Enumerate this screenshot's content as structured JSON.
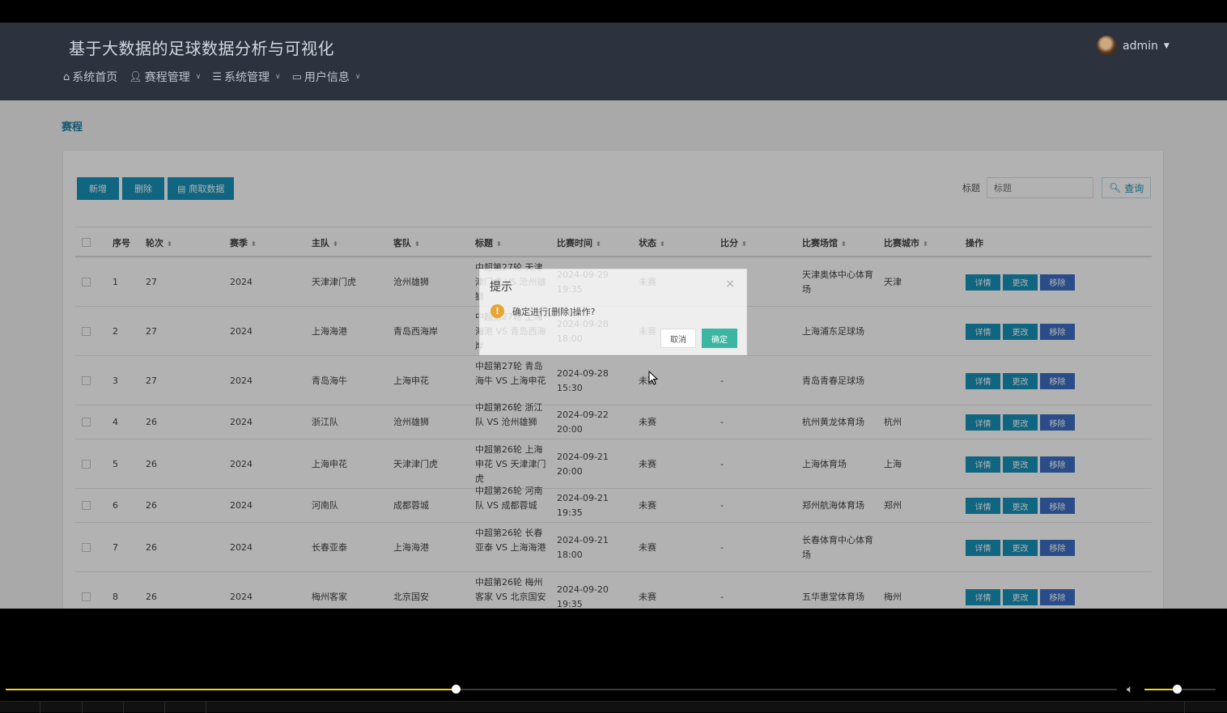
{
  "header": {
    "app_title": "基于大数据的足球数据分析与可视化",
    "nav": [
      {
        "label": "系统首页",
        "icon": "home-icon",
        "has_dropdown": false
      },
      {
        "label": "赛程管理",
        "icon": "user-icon",
        "has_dropdown": true
      },
      {
        "label": "系统管理",
        "icon": "list-icon",
        "has_dropdown": true
      },
      {
        "label": "用户信息",
        "icon": "card-icon",
        "has_dropdown": true
      }
    ],
    "user": "admin"
  },
  "breadcrumb": "赛程",
  "toolbar": {
    "add_label": "新增",
    "delete_label": "删除",
    "crawl_label": "爬取数据"
  },
  "search": {
    "label": "标题",
    "placeholder": "标题",
    "button_label": "查询"
  },
  "table": {
    "columns": [
      "序号",
      "轮次",
      "赛季",
      "主队",
      "客队",
      "标题",
      "比赛时间",
      "状态",
      "比分",
      "比赛场馆",
      "比赛城市",
      "操作"
    ],
    "op_labels": {
      "detail": "详情",
      "edit": "更改",
      "remove": "移除"
    },
    "rows": [
      {
        "no": "1",
        "round": "27",
        "season": "2024",
        "home": "天津津门虎",
        "away": "沧州雄狮",
        "title": "中超第27轮 天津津门虎 VS 沧州雄狮",
        "time": "2024-09-29 19:35",
        "status": "未赛",
        "score": "",
        "venue": "天津奥体中心体育场",
        "city": "天津"
      },
      {
        "no": "2",
        "round": "27",
        "season": "2024",
        "home": "上海海港",
        "away": "青岛西海岸",
        "title": "中超第27轮 上海海港 VS 青岛西海岸",
        "time": "2024-09-28 18:00",
        "status": "未赛",
        "score": "",
        "venue": "上海浦东足球场",
        "city": ""
      },
      {
        "no": "3",
        "round": "27",
        "season": "2024",
        "home": "青岛海牛",
        "away": "上海申花",
        "title": "中超第27轮 青岛海牛 VS 上海申花",
        "time": "2024-09-28 15:30",
        "status": "未赛",
        "score": "-",
        "venue": "青岛青春足球场",
        "city": ""
      },
      {
        "no": "4",
        "round": "26",
        "season": "2024",
        "home": "浙江队",
        "away": "沧州雄狮",
        "title": "中超第26轮 浙江队 VS 沧州雄狮",
        "time": "2024-09-22 20:00",
        "status": "未赛",
        "score": "-",
        "venue": "杭州黄龙体育场",
        "city": "杭州"
      },
      {
        "no": "5",
        "round": "26",
        "season": "2024",
        "home": "上海申花",
        "away": "天津津门虎",
        "title": "中超第26轮 上海申花 VS 天津津门虎",
        "time": "2024-09-21 20:00",
        "status": "未赛",
        "score": "-",
        "venue": "上海体育场",
        "city": "上海"
      },
      {
        "no": "6",
        "round": "26",
        "season": "2024",
        "home": "河南队",
        "away": "成都蓉城",
        "title": "中超第26轮 河南队 VS 成都蓉城",
        "time": "2024-09-21 19:35",
        "status": "未赛",
        "score": "-",
        "venue": "郑州航海体育场",
        "city": "郑州"
      },
      {
        "no": "7",
        "round": "26",
        "season": "2024",
        "home": "长春亚泰",
        "away": "上海海港",
        "title": "中超第26轮 长春亚泰 VS 上海海港",
        "time": "2024-09-21 18:00",
        "status": "未赛",
        "score": "-",
        "venue": "长春体育中心体育场",
        "city": ""
      },
      {
        "no": "8",
        "round": "26",
        "season": "2024",
        "home": "梅州客家",
        "away": "北京国安",
        "title": "中超第26轮 梅州客家 VS 北京国安",
        "time": "2024-09-20 19:35",
        "status": "未赛",
        "score": "-",
        "venue": "五华惠堂体育场",
        "city": "梅州"
      }
    ]
  },
  "dialog": {
    "title": "提示",
    "message": "确定进行[删除]操作?",
    "cancel_label": "取消",
    "ok_label": "确定"
  },
  "player": {
    "progress": 0.405,
    "volume": 0.45
  },
  "colors": {
    "header_bg": "#2f3542",
    "primary": "#1791b8",
    "remove": "#3d6fc4",
    "ok": "#3cb6a3",
    "progress": "#f0d020"
  }
}
